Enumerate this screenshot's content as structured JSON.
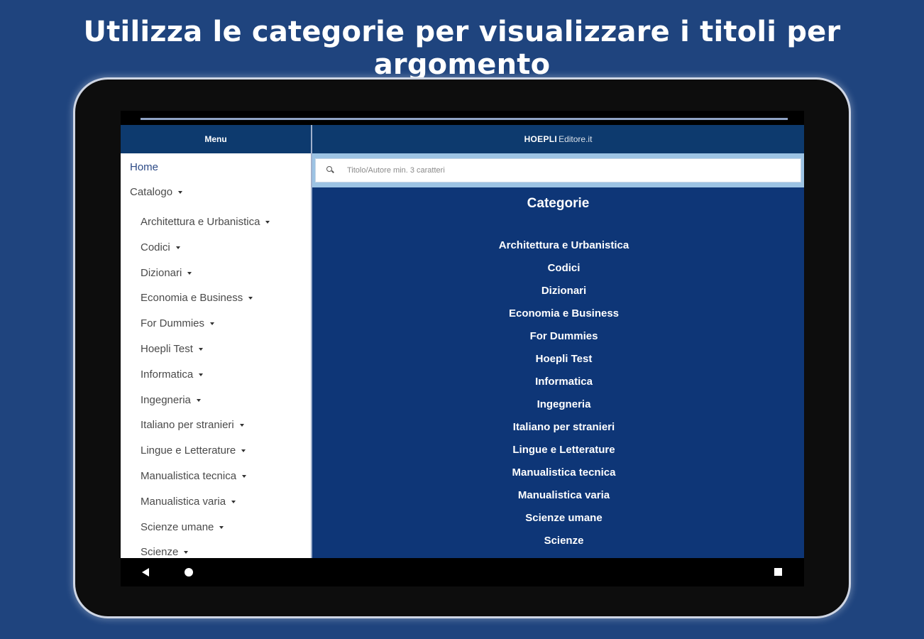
{
  "headline": "Utilizza le categorie per visualizzare i titoli per argomento",
  "sidebar": {
    "header": "Menu",
    "home": "Home",
    "catalogo": "Catalogo",
    "items": [
      "Architettura e Urbanistica",
      "Codici",
      "Dizionari",
      "Economia e Business",
      "For Dummies",
      "Hoepli Test",
      "Informatica",
      "Ingegneria",
      "Italiano per stranieri",
      "Lingue e Letterature",
      "Manualistica tecnica",
      "Manualistica varia",
      "Scienze umane",
      "Scienze"
    ]
  },
  "header": {
    "brand_bold": "HOEPLI",
    "brand_light": "Editore.it"
  },
  "search": {
    "placeholder": "Titolo/Autore min. 3 caratteri",
    "icon": "search-icon"
  },
  "main": {
    "title": "Categorie",
    "categories": [
      "Architettura e Urbanistica",
      "Codici",
      "Dizionari",
      "Economia e Business",
      "For Dummies",
      "Hoepli Test",
      "Informatica",
      "Ingegneria",
      "Italiano per stranieri",
      "Lingue e Letterature",
      "Manualistica tecnica",
      "Manualistica varia",
      "Scienze umane",
      "Scienze"
    ]
  },
  "navbar": {
    "back_icon": "back-triangle-icon",
    "home_icon": "home-circle-icon",
    "recents_icon": "recents-square-icon"
  },
  "colors": {
    "background": "#1f447e",
    "header": "#0d3a6e",
    "main": "#0e3677",
    "search_band": "#9cc3e4"
  }
}
